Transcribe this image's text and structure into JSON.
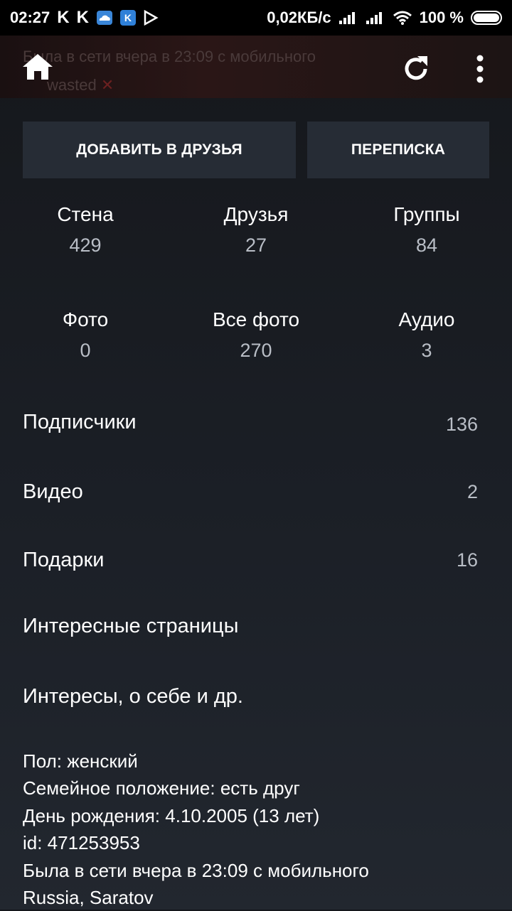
{
  "status_bar": {
    "time": "02:27",
    "notifications": [
      "K",
      "K",
      "cloud-icon",
      "K",
      "play-icon"
    ],
    "net_speed": "0,02КБ/с",
    "battery_text": "100 %",
    "battery_level": 1.0
  },
  "header": {
    "ghost_status": "Была в сети вчера в 23:09 с мобильного",
    "ghost_name": "wasted"
  },
  "actions": {
    "add_friend": "ДОБАВИТЬ В ДРУЗЬЯ",
    "messages": "ПЕРЕПИСКА"
  },
  "stats": [
    {
      "label": "Стена",
      "value": "429"
    },
    {
      "label": "Друзья",
      "value": "27"
    },
    {
      "label": "Группы",
      "value": "84"
    },
    {
      "label": "Фото",
      "value": "0"
    },
    {
      "label": "Все фото",
      "value": "270"
    },
    {
      "label": "Аудио",
      "value": "3"
    }
  ],
  "rows": [
    {
      "label": "Подписчики",
      "count": "136"
    },
    {
      "label": "Видео",
      "count": "2"
    },
    {
      "label": "Подарки",
      "count": "16"
    },
    {
      "label": "Интересные страницы",
      "count": ""
    },
    {
      "label": "Интересы, о себе и др.",
      "count": ""
    }
  ],
  "info": [
    "Пол: женский",
    "Семейное положение: есть друг",
    "День рождения: 4.10.2005 (13 лет)",
    "id: 471253953",
    "Была в сети вчера в 23:09 с мобильного",
    "Russia, Saratov"
  ]
}
